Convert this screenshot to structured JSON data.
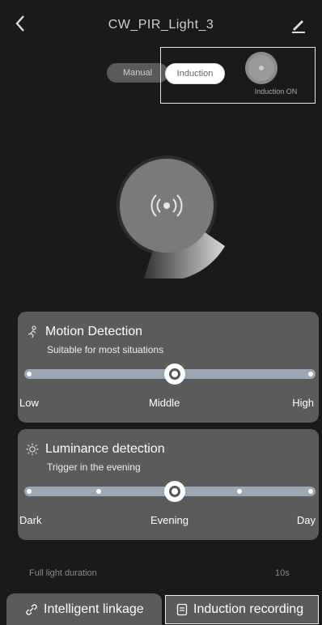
{
  "header": {
    "title": "CW_PIR_Light_3",
    "back_icon": "chevron-left-icon",
    "edit_icon": "edit-icon"
  },
  "mode": {
    "manual_label": "Manual",
    "induction_label": "Induction",
    "induction_status_label": "Induction ON"
  },
  "motion_card": {
    "title": "Motion Detection",
    "subtitle": "Suitable for most situations",
    "icon": "running-person-icon",
    "labels": [
      "Low",
      "Middle",
      "High"
    ],
    "selected_index": 1,
    "steps": 3
  },
  "luminance_card": {
    "title": "Luminance detection",
    "subtitle": "Trigger in the evening",
    "icon": "sun-icon",
    "labels": [
      "Dark",
      "Evening",
      "Day"
    ],
    "selected_index": 2,
    "steps": 5
  },
  "duration": {
    "label": "Full light duration",
    "value": "10s"
  },
  "tabs": {
    "intelligent_linkage": "Intelligent linkage",
    "induction_recording": "Induction recording"
  }
}
